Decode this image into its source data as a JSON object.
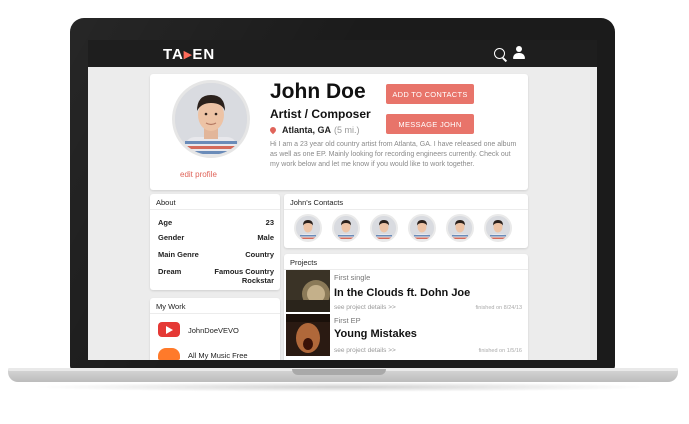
{
  "app": {
    "logo": {
      "left": "TA",
      "arrow": "▸",
      "right": "EN"
    }
  },
  "profile": {
    "name": "John Doe",
    "role": "Artist / Composer",
    "location": "Atlanta, GA",
    "distance": "(5 mi.)",
    "bio": "Hi I am a 23 year old country artist from Atlanta, GA. I have released one album as well as one EP. Mainly looking for recording engineers currently. Check out my work below and let me know if you would like to work together.",
    "edit_label": "edit profile",
    "add_contact_label": "ADD TO CONTACTS",
    "message_label": "MESSAGE JOHN"
  },
  "about": {
    "title": "About",
    "rows": [
      {
        "label": "Age",
        "value": "23"
      },
      {
        "label": "Gender",
        "value": "Male"
      },
      {
        "label": "Main Genre",
        "value": "Country"
      },
      {
        "label": "Dream",
        "value": "Famous Country Rockstar"
      }
    ]
  },
  "mywork": {
    "title": "My Work",
    "items": [
      {
        "label": "JohnDoeVEVO",
        "icon": "youtube-icon"
      },
      {
        "label": "All My Music Free",
        "icon": "soundcloud-icon"
      }
    ]
  },
  "contacts": {
    "title": "John's Contacts",
    "count": 6
  },
  "projects": {
    "title": "Projects",
    "items": [
      {
        "kicker": "First single",
        "title": "In the Clouds ft. Dohn Joe",
        "details": "see project details >>",
        "date": "finished on 8/24/13"
      },
      {
        "kicker": "First EP",
        "title": "Young Mistakes",
        "details": "see project details >>",
        "date": "finished on 1/5/16"
      }
    ]
  },
  "colors": {
    "accent": "#e8746a",
    "topbar": "#1e1e1e",
    "background": "#ececec"
  }
}
